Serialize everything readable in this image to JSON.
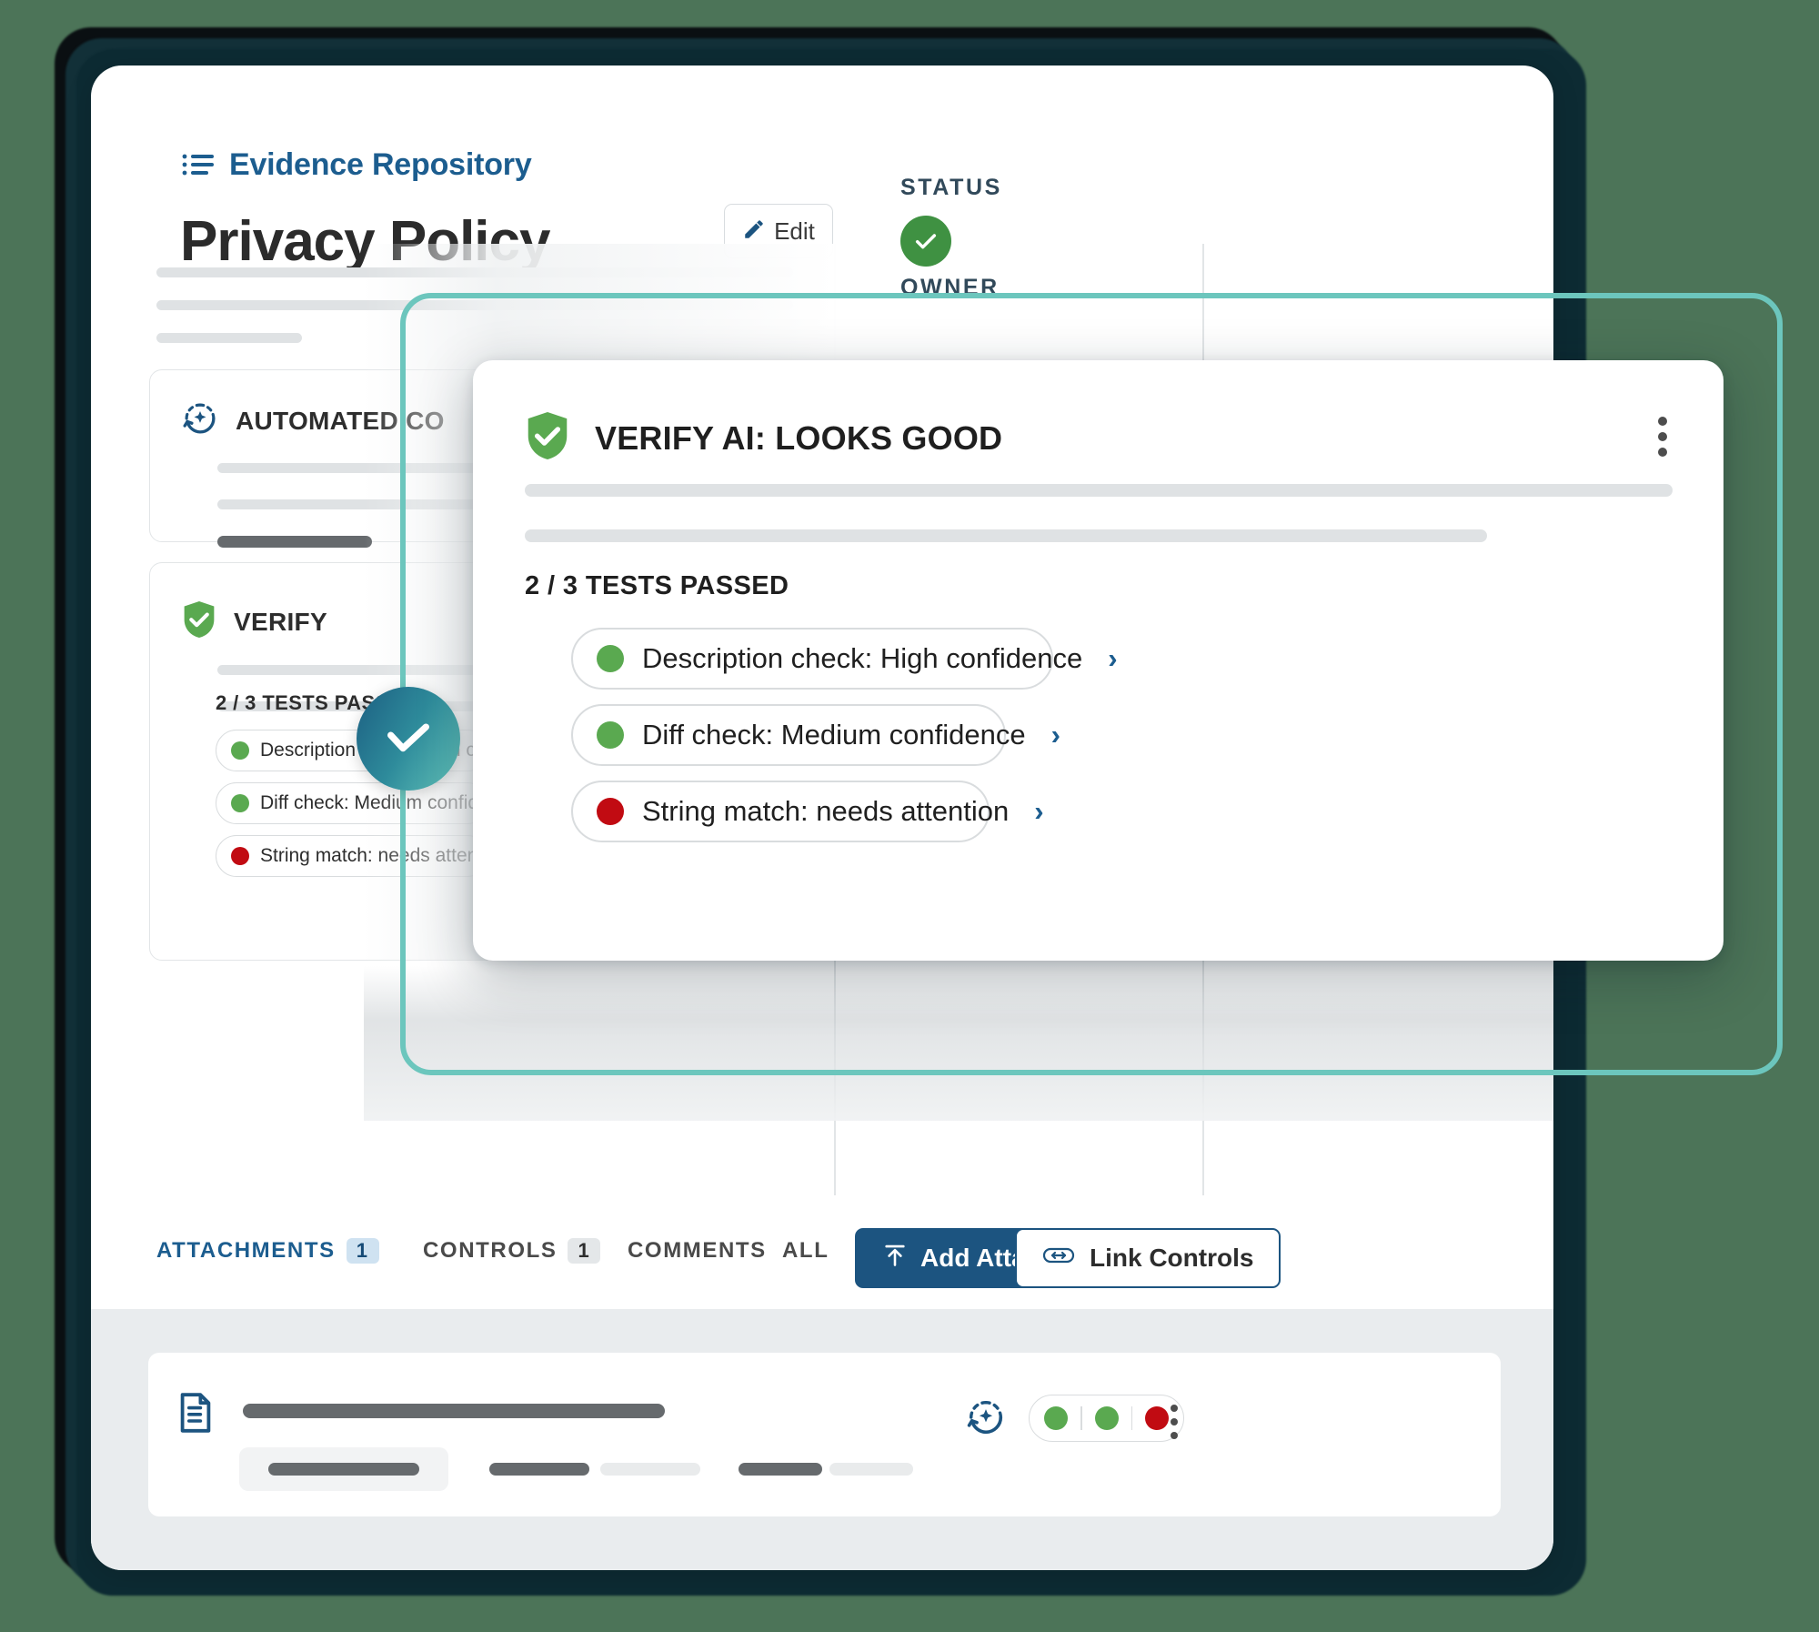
{
  "breadcrumb": {
    "label": "Evidence Repository",
    "icon": "list-icon"
  },
  "header": {
    "title": "Privacy Policy",
    "edit_button": {
      "label": "Edit",
      "icon": "pencil-icon"
    }
  },
  "meta": {
    "status_label": "STATUS",
    "status_value_icon": "check-circle-icon",
    "owner_label": "OWNER"
  },
  "cards": {
    "automated": {
      "title": "AUTOMATED CO",
      "icon": "ai-refresh-icon"
    },
    "verify": {
      "title": "VERIFY",
      "icon": "shield-check-icon",
      "tests_passed": "2 / 3 TESTS PASSED",
      "checks": [
        {
          "label": "Description check: High confidence",
          "status_color": "#5aa950",
          "chevron": "›"
        },
        {
          "label": "Diff check: Medium confidence",
          "status_color": "#5aa950",
          "chevron": "›"
        },
        {
          "label": "String match: needs attention",
          "status_color": "#c10b12",
          "chevron": "›"
        }
      ]
    }
  },
  "modal": {
    "icon": "shield-check-icon",
    "title": "VERIFY AI: LOOKS GOOD",
    "menu_icon": "kebab-menu-icon",
    "tests_passed": "2 / 3 TESTS PASSED",
    "checks": [
      {
        "label": "Description check: High confidence",
        "status_color": "#5aa950",
        "chevron": "›"
      },
      {
        "label": "Diff check: Medium confidence",
        "status_color": "#5aa950",
        "chevron": "›"
      },
      {
        "label": "String match: needs attention",
        "status_color": "#c10b12",
        "chevron": "›"
      }
    ]
  },
  "tabs": [
    {
      "label": "ATTACHMENTS",
      "badge": "1",
      "active": true
    },
    {
      "label": "CONTROLS",
      "badge": "1",
      "active": false
    },
    {
      "label": "COMMENTS",
      "badge": "",
      "active": false
    },
    {
      "label": "ALL",
      "badge": "",
      "active": false
    }
  ],
  "actions": {
    "add_attachment": {
      "label": "Add Attachment",
      "icon": "upload-icon"
    },
    "link_controls": {
      "label": "Link Controls",
      "icon": "link-icon"
    }
  },
  "attachment_row": {
    "file_icon": "document-icon",
    "ai_icon": "ai-refresh-icon",
    "menu_icon": "kebab-menu-icon",
    "status_dots": [
      "#5aa950",
      "#5aa950",
      "#c10b12"
    ]
  },
  "colors": {
    "brand_blue": "#1c5480",
    "link_blue": "#1c5d8f",
    "teal": "#6cc6bd",
    "green": "#3f9142",
    "pill_green": "#5aa950",
    "pill_red": "#c10b12",
    "page_bg": "#4c7458"
  },
  "overlay": {
    "highlight_icon": "check-icon"
  }
}
